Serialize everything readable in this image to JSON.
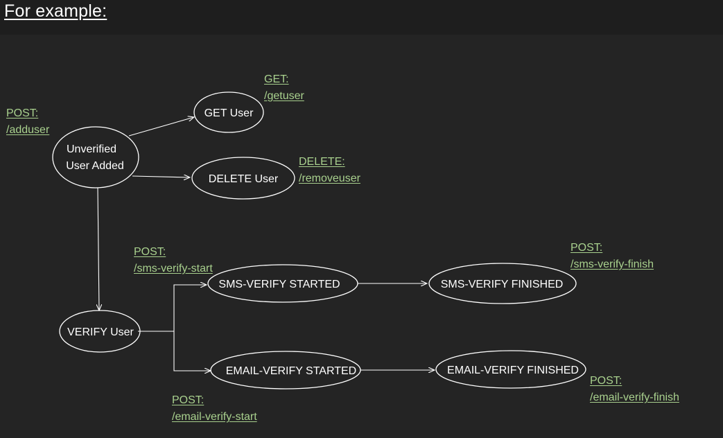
{
  "title": "For example:",
  "colors": {
    "background": "#242424",
    "title_bar": "#1e1e1e",
    "node_stroke": "#ffffff",
    "text": "#ffffff",
    "endpoint_label": "#a9d18e"
  },
  "nodes": {
    "unverified": {
      "line1": "Unverified",
      "line2": "User Added"
    },
    "get_user": {
      "label": "GET User"
    },
    "delete_user": {
      "label": "DELETE User"
    },
    "verify_user": {
      "label": "VERIFY User"
    },
    "sms_started": {
      "label": "SMS-VERIFY STARTED"
    },
    "sms_finished": {
      "label": "SMS-VERIFY FINISHED"
    },
    "email_started": {
      "label": "EMAIL-VERIFY STARTED"
    },
    "email_finished": {
      "label": "EMAIL-VERIFY FINISHED"
    }
  },
  "endpoints": {
    "adduser": {
      "method": "POST:",
      "path": "/adduser"
    },
    "getuser": {
      "method": "GET:",
      "path": "/getuser"
    },
    "removeuser": {
      "method": "DELETE:",
      "path": "/removeuser"
    },
    "sms_start": {
      "method": "POST:",
      "path": "/sms-verify-start"
    },
    "sms_finish": {
      "method": "POST:",
      "path": "/sms-verify-finish"
    },
    "email_start": {
      "method": "POST:",
      "path": "/email-verify-start"
    },
    "email_finish": {
      "method": "POST:",
      "path": "/email-verify-finish"
    }
  }
}
